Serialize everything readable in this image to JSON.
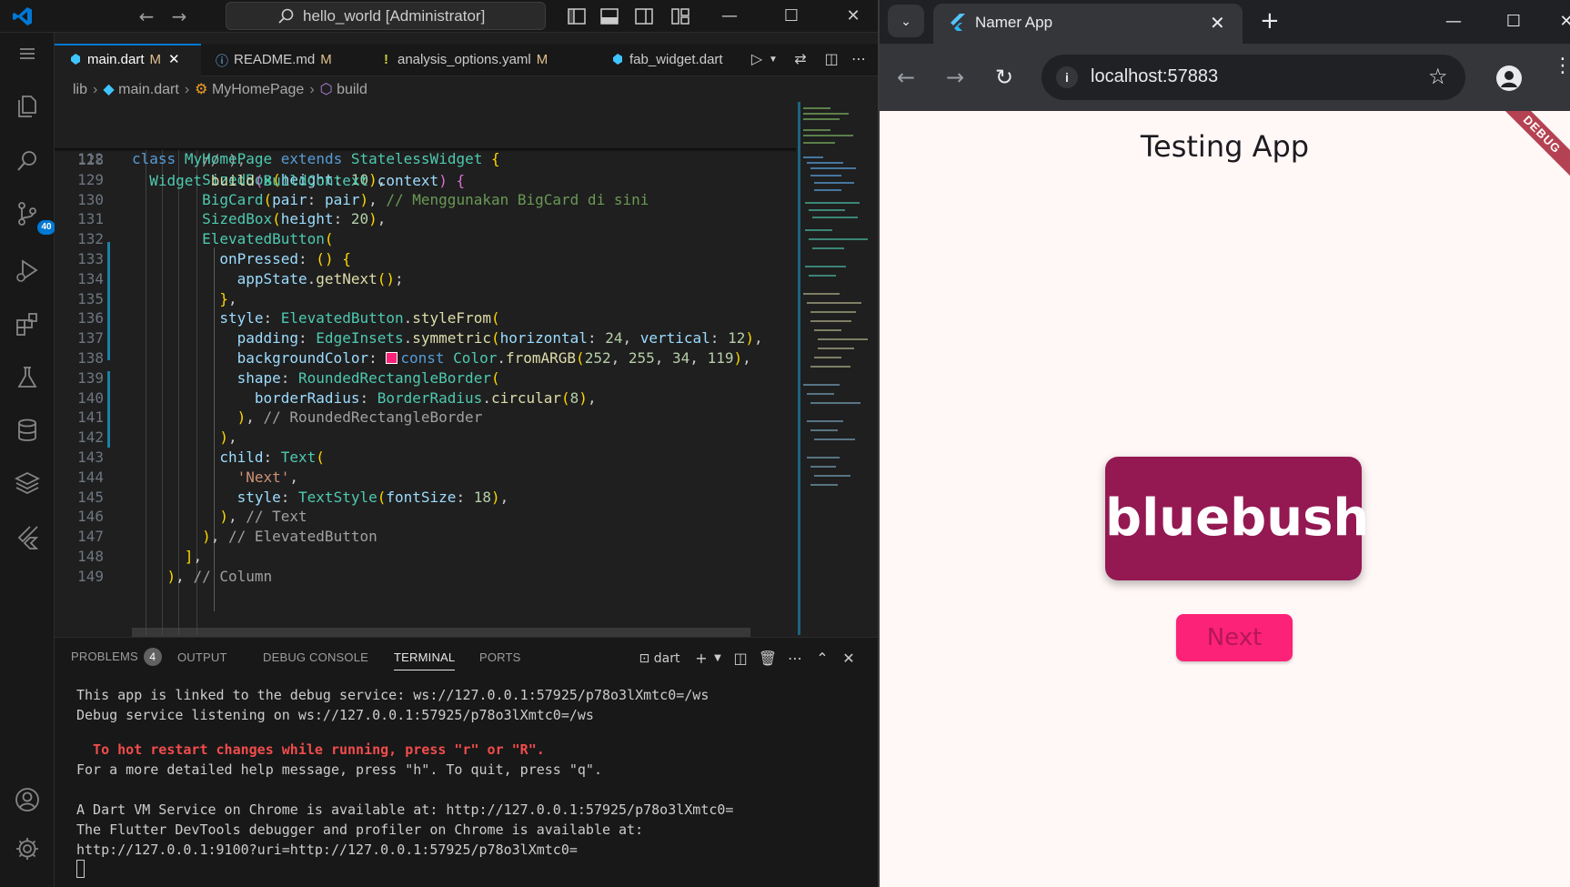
{
  "vscode": {
    "command_center": "hello_world [Administrator]",
    "scm_badge": "40",
    "tabs": [
      {
        "label": "main.dart",
        "status": "M",
        "active": true
      },
      {
        "label": "README.md",
        "status": "M"
      },
      {
        "label": "analysis_options.yaml",
        "status": "M"
      },
      {
        "label": "fab_widget.dart"
      }
    ],
    "breadcrumb": [
      "lib",
      "main.dart",
      "MyHomePage",
      "build"
    ],
    "sticky_lines": [
      {
        "num": "110",
        "text": "class MyHomePage extends StatelessWidget {"
      },
      {
        "num": "112",
        "text": "Widget build(BuildContext context) {"
      }
    ],
    "code_lines": [
      {
        "num": "128",
        "text": "        // ),"
      },
      {
        "num": "129",
        "text": "        SizedBox(height: 10),"
      },
      {
        "num": "130",
        "text": "        BigCard(pair: pair), // Menggunakan BigCard di sini"
      },
      {
        "num": "131",
        "text": "        SizedBox(height: 20),"
      },
      {
        "num": "132",
        "text": "        ElevatedButton("
      },
      {
        "num": "133",
        "text": "          onPressed: () {"
      },
      {
        "num": "134",
        "text": "            appState.getNext();"
      },
      {
        "num": "135",
        "text": "          },"
      },
      {
        "num": "136",
        "text": "          style: ElevatedButton.styleFrom("
      },
      {
        "num": "137",
        "text": "            padding: EdgeInsets.symmetric(horizontal: 24, vertical: 12),"
      },
      {
        "num": "138",
        "text": "            backgroundColor: const Color.fromARGB(252, 255, 34, 119),"
      },
      {
        "num": "139",
        "text": "            shape: RoundedRectangleBorder("
      },
      {
        "num": "140",
        "text": "              borderRadius: BorderRadius.circular(8),"
      },
      {
        "num": "141",
        "text": "            ), // RoundedRectangleBorder"
      },
      {
        "num": "142",
        "text": "          ),"
      },
      {
        "num": "143",
        "text": "          child: Text("
      },
      {
        "num": "144",
        "text": "            'Next',"
      },
      {
        "num": "145",
        "text": "            style: TextStyle(fontSize: 18),"
      },
      {
        "num": "146",
        "text": "          ), // Text"
      },
      {
        "num": "147",
        "text": "        ), // ElevatedButton"
      },
      {
        "num": "148",
        "text": "      ],"
      },
      {
        "num": "149",
        "text": "    ), // Column"
      }
    ],
    "panel_tabs": [
      {
        "label": "PROBLEMS",
        "count": "4"
      },
      {
        "label": "OUTPUT"
      },
      {
        "label": "DEBUG CONSOLE"
      },
      {
        "label": "TERMINAL",
        "active": true
      },
      {
        "label": "PORTS"
      }
    ],
    "terminal_shell": "dart",
    "terminal_lines": [
      "This app is linked to the debug service: ws://127.0.0.1:57925/p78o3lXmtc0=/ws",
      "Debug service listening on ws://127.0.0.1:57925/p78o3lXmtc0=/ws",
      "",
      "  To hot restart changes while running, press \"r\" or \"R\".",
      "For a more detailed help message, press \"h\". To quit, press \"q\".",
      "",
      "A Dart VM Service on Chrome is available at: http://127.0.0.1:57925/p78o3lXmtc0=",
      "The Flutter DevTools debugger and profiler on Chrome is available at:",
      "http://127.0.0.1:9100?uri=http://127.0.0.1:57925/p78o3lXmtc0="
    ]
  },
  "chrome": {
    "tab_title": "Namer App",
    "url": "localhost:57883",
    "app": {
      "title": "Testing App",
      "word_pair": "bluebush",
      "next_label": "Next",
      "debug_banner": "DEBUG"
    }
  },
  "colors": {
    "vscode_bg": "#1f1f1f",
    "accent": "#0078d4",
    "card": "#941852",
    "next_button": "#fc2277",
    "app_bg": "#fff8f7"
  }
}
